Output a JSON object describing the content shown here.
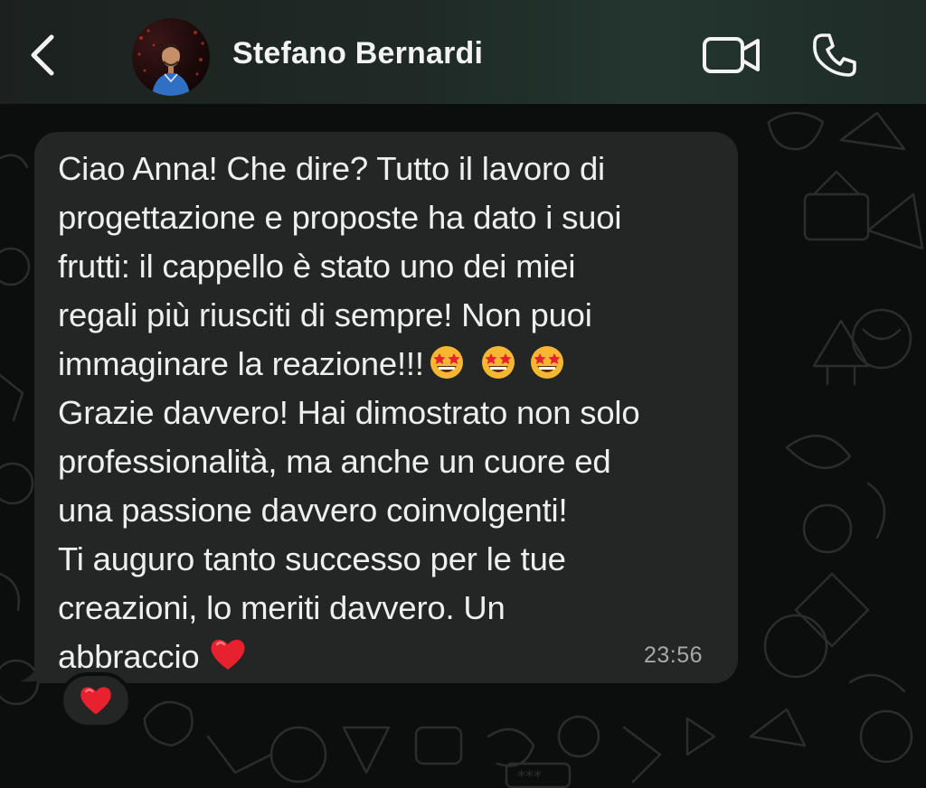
{
  "header": {
    "back_icon": "chevron-left-icon",
    "contact_name": "Stefano Bernardi",
    "video_icon": "video-camera-icon",
    "call_icon": "phone-icon"
  },
  "message": {
    "lines": [
      "Ciao Anna! Che dire? Tutto il lavoro di",
      "progettazione e proposte ha dato i suoi",
      "frutti: ",
      "il cappello è stato uno dei miei",
      "regali più riusciti di sempre! Non puoi",
      "immaginare la reazione!!!",
      "Grazie davvero! Hai dimostrato non solo",
      "professionalità, ma anche un cuore ed",
      "una passione davvero coinvolgenti!",
      "Ti auguro tanto successo per le tue",
      "creazioni, lo meriti davvero. Un",
      "abbraccio "
    ],
    "highlight_color": "#f2ef3a",
    "emoji_after_reazione": "star-struck-emoji x3",
    "emoji_after_abbraccio": "red-heart-emoji",
    "timestamp": "23:56"
  },
  "reaction": {
    "icon": "red-heart-emoji"
  },
  "colors": {
    "bubble": "#242626",
    "background": "#0c0e0d",
    "heart": "#e8212e",
    "star_face": "#f7b731"
  }
}
